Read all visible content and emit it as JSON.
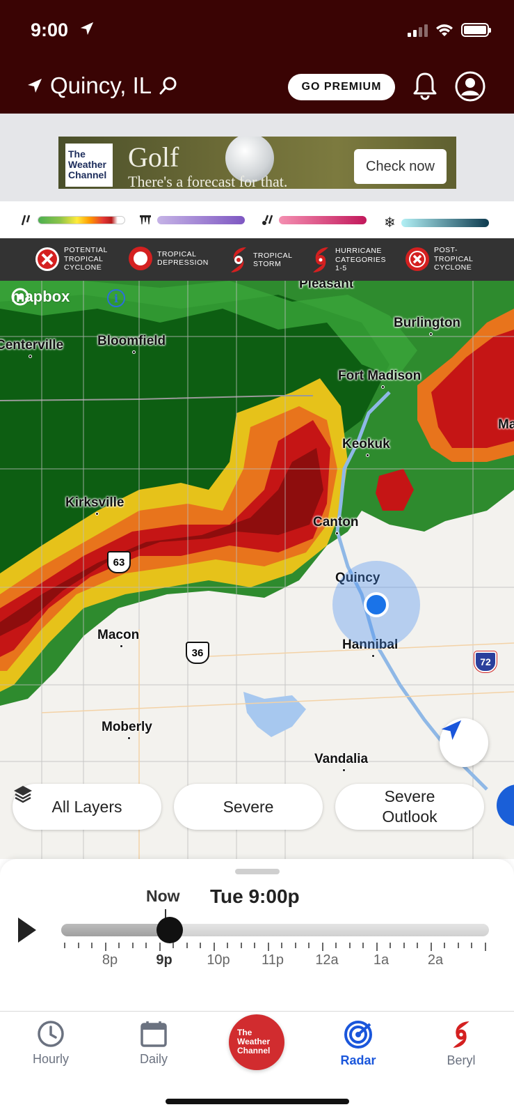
{
  "status_bar": {
    "time": "9:00"
  },
  "header": {
    "location": "Quincy, IL",
    "premium_label": "GO PREMIUM"
  },
  "ad": {
    "logo": [
      "The",
      "Weather",
      "Channel"
    ],
    "headline": "Golf",
    "tagline": "There's a forecast for that.",
    "cta": "Check now"
  },
  "precip_legend": [
    {
      "icon": "rain-icon",
      "colors": [
        "#4caf50",
        "#ffeb3b",
        "#f44336",
        "#ffffff"
      ]
    },
    {
      "icon": "ice-icon",
      "colors": [
        "#b39ddb",
        "#7e57c2"
      ]
    },
    {
      "icon": "mix-icon",
      "colors": [
        "#f48fb1",
        "#c2185b"
      ]
    },
    {
      "icon": "snow-icon",
      "colors": [
        "#b2f0f5",
        "#0d3b4f"
      ]
    }
  ],
  "storm_legend": [
    {
      "icon": "potential-tropical-cyclone-icon",
      "lines": [
        "POTENTIAL",
        "TROPICAL",
        "CYCLONE"
      ]
    },
    {
      "icon": "tropical-depression-icon",
      "lines": [
        "TROPICAL",
        "DEPRESSION"
      ]
    },
    {
      "icon": "tropical-storm-icon",
      "lines": [
        "TROPICAL",
        "STORM"
      ]
    },
    {
      "icon": "hurricane-icon",
      "lines": [
        "HURRICANE",
        "CATEGORIES",
        "1-5"
      ]
    },
    {
      "icon": "post-tropical-cyclone-icon",
      "lines": [
        "POST-",
        "TROPICAL",
        "CYCLONE"
      ]
    }
  ],
  "map": {
    "attribution": "mapbox",
    "cities": [
      "Pleasant",
      "Burlington",
      "Centerville",
      "Bloomfield",
      "Fort Madison",
      "Keokuk",
      "Kirksville",
      "Canton",
      "Quincy",
      "Macon",
      "Hannibal",
      "Moberly",
      "Vandalia",
      "Ma"
    ],
    "route_shields": [
      "63",
      "36"
    ],
    "interstate_shields": [
      "72"
    ]
  },
  "layers": {
    "all": "All Layers",
    "severe": "Severe",
    "outlook_line1": "Severe",
    "outlook_line2": "Outlook"
  },
  "timeline": {
    "now_label": "Now",
    "current_time": "Tue 9:00p",
    "position_fraction": 0.254,
    "hours": [
      "8p",
      "9p",
      "10p",
      "11p",
      "12a",
      "1a",
      "2a"
    ],
    "current_hour": "9p"
  },
  "nav": {
    "hourly": "Hourly",
    "daily": "Daily",
    "logo_lines": [
      "The",
      "Weather",
      "Channel"
    ],
    "radar": "Radar",
    "beryl": "Beryl"
  },
  "colors": {
    "header_bg": "#3a0404",
    "accent_blue": "#1a56db",
    "twc_red": "#d12c2f",
    "storm_red": "#d42020"
  }
}
